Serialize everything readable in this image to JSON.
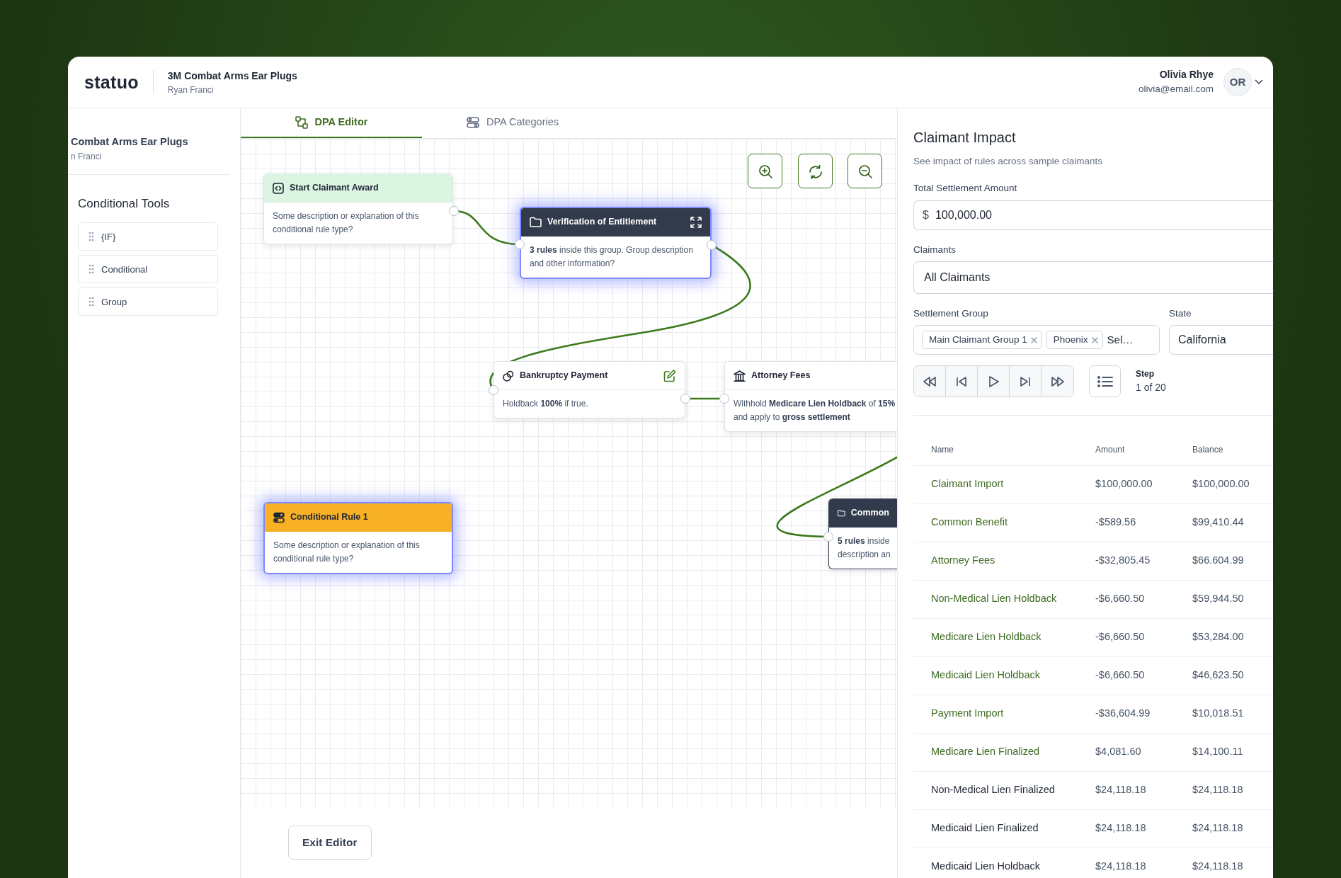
{
  "header": {
    "logo": "statuo",
    "project": "3M Combat Arms Ear Plugs",
    "owner": "Ryan Franci",
    "user": {
      "name": "Olivia Rhye",
      "email": "olivia@email.com",
      "initials": "OR"
    }
  },
  "sidebar": {
    "project": "Combat Arms Ear Plugs",
    "owner": "n Franci",
    "tools_title": "Conditional Tools",
    "tools": [
      "{IF}",
      "Conditional",
      "Group"
    ]
  },
  "tabs": [
    {
      "label": "DPA Editor",
      "selected": true
    },
    {
      "label": "DPA Categories",
      "selected": false
    }
  ],
  "canvas": {
    "nodes": [
      {
        "kind": "start",
        "title": "Start Claimant Award",
        "body": "Some description or explanation of this conditional rule type?",
        "selected": false
      },
      {
        "kind": "group",
        "title": "Verification of Entitlement",
        "body": "**3 rules** inside this group. Group description and other information?",
        "selected": true
      },
      {
        "kind": "rule",
        "title": "Bankruptcy Payment",
        "body": "Holdback **100%** if true.",
        "selected": false
      },
      {
        "kind": "rule",
        "title": "Attorney Fees",
        "body": "Withhold **Medicare Lien Holdback** of **15%** and apply to **gross settlement**",
        "selected": false
      },
      {
        "kind": "conditional",
        "title": "Conditional Rule 1",
        "body": "Some description or explanation of this conditional rule type?",
        "selected": true
      },
      {
        "kind": "group",
        "title": "Common",
        "body": "**5 rules** inside description an",
        "selected": false
      }
    ]
  },
  "exit_button": "Exit Editor",
  "impact": {
    "title": "Claimant Impact",
    "subtitle": "See impact of rules across sample claimants",
    "total": {
      "label": "Total Settlement Amount",
      "prefix": "$",
      "value": "100,000.00"
    },
    "claimants": {
      "label": "Claimants",
      "value": "All Claimants"
    },
    "group": {
      "label": "Settlement Group",
      "chips": [
        "Main Claimant Group 1",
        "Phoenix"
      ],
      "placeholder": "Sel…"
    },
    "state": {
      "label": "State",
      "value": "California"
    },
    "step": {
      "label": "Step",
      "value": "1 of 20"
    },
    "table": {
      "columns": [
        "Name",
        "Amount",
        "Balance"
      ],
      "rows": [
        {
          "name": "Claimant Import",
          "amount": "$100,000.00",
          "balance": "$100,000.00",
          "linked": true
        },
        {
          "name": "Common Benefit",
          "amount": "-$589.56",
          "balance": "$99,410.44",
          "linked": true
        },
        {
          "name": "Attorney Fees",
          "amount": "-$32,805.45",
          "balance": "$66.604.99",
          "linked": true
        },
        {
          "name": "Non-Medical Lien Holdback",
          "amount": "-$6,660.50",
          "balance": "$59,944.50",
          "linked": true
        },
        {
          "name": "Medicare Lien Holdback",
          "amount": "-$6,660.50",
          "balance": "$53,284.00",
          "linked": true
        },
        {
          "name": "Medicaid Lien Holdback",
          "amount": "-$6,660.50",
          "balance": "$46,623.50",
          "linked": true
        },
        {
          "name": "Payment Import",
          "amount": "-$36,604.99",
          "balance": "$10,018.51",
          "linked": true
        },
        {
          "name": "Medicare Lien Finalized",
          "amount": "$4,081.60",
          "balance": "$14,100.11",
          "linked": true
        },
        {
          "name": "Non-Medical Lien Finalized",
          "amount": "$24,118.18",
          "balance": "$24,118.18",
          "linked": false
        },
        {
          "name": "Medicaid Lien Finalized",
          "amount": "$24,118.18",
          "balance": "$24,118.18",
          "linked": false
        },
        {
          "name": "Medicaid Lien Holdback",
          "amount": "$24,118.18",
          "balance": "$24,118.18",
          "linked": false
        }
      ]
    }
  }
}
